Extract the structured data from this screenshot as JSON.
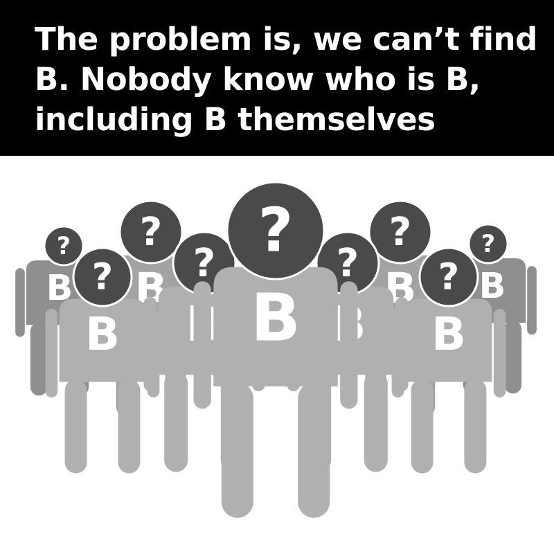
{
  "caption": {
    "text": "The problem is, we can’t find B. Nobody know who is B, including B themselves"
  },
  "figure": {
    "head_glyph": "?",
    "body_letter": "B",
    "colors": {
      "background": "#ffffff",
      "caption_background": "#000000",
      "caption_text": "#ffffff",
      "head": "#4a4a4a",
      "body_light": "#b0b0b0",
      "body_mid": "#a3a3a3",
      "body_dark": "#8f8f8f",
      "glyph": "#ffffff"
    },
    "people_count": 9
  }
}
